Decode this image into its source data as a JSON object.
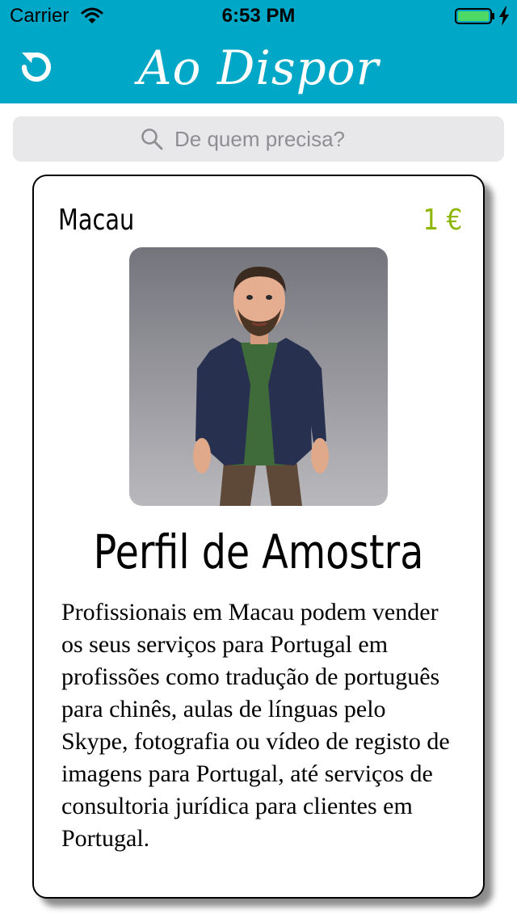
{
  "status_bar": {
    "carrier": "Carrier",
    "time": "6:53 PM",
    "battery_level": 1.0,
    "icons": [
      "wifi-icon",
      "battery-icon",
      "charging-bolt-icon"
    ]
  },
  "header": {
    "title": "Ao Dispor",
    "refresh_icon": "refresh-icon",
    "background_color": "#00a7c7"
  },
  "search": {
    "placeholder": "De quem precisa?",
    "value": "",
    "icon": "search-icon"
  },
  "card": {
    "location": "Macau",
    "price": "1 €",
    "price_color": "#8db600",
    "name": "Perfil de Amostra",
    "description": "Profissionais em Macau podem vender os seus serviços para Portugal em profissões como tradução de português para chinês, aulas de línguas pelo Skype, fotografia ou vídeo de registo de imagens para Portugal, até serviços de consultoria jurídica para clientes em Portugal."
  }
}
